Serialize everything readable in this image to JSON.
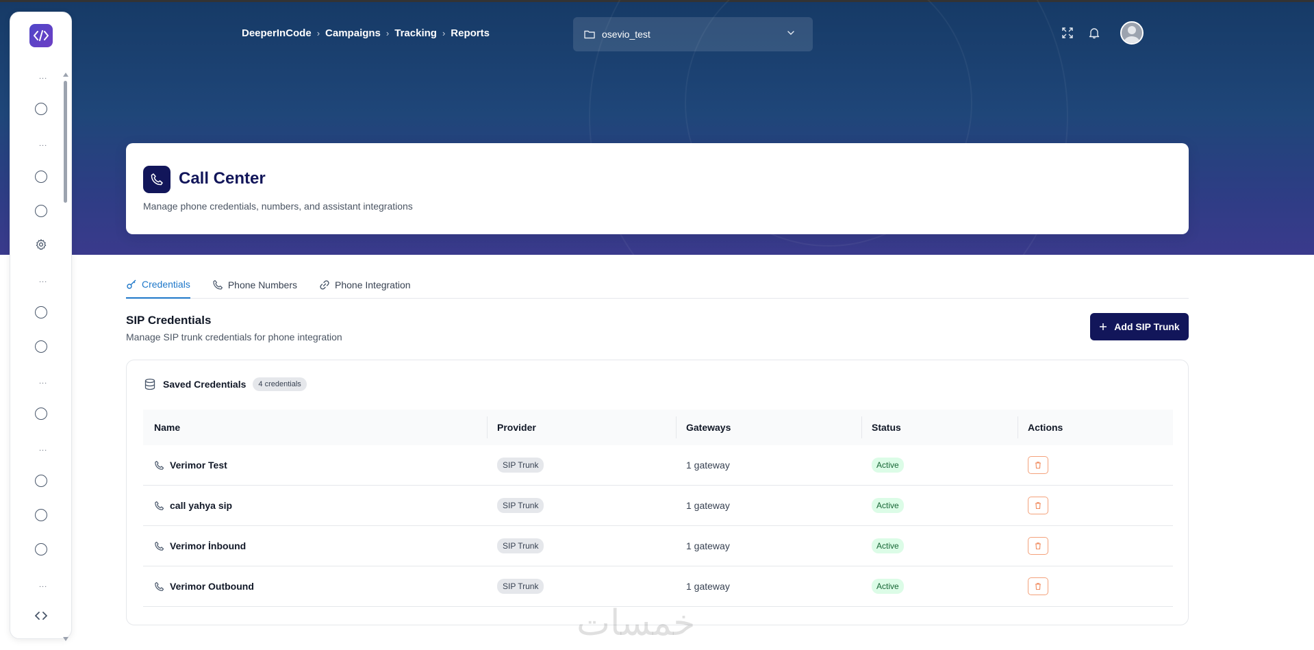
{
  "breadcrumb": [
    "DeeperInCode",
    "Campaigns",
    "Tracking",
    "Reports"
  ],
  "workspace": {
    "name": "osevio_test"
  },
  "header": {
    "title": "Call Center",
    "subtitle": "Manage phone credentials, numbers, and assistant integrations"
  },
  "tabs": [
    {
      "label": "Credentials",
      "icon": "key-icon",
      "active": true
    },
    {
      "label": "Phone Numbers",
      "icon": "phone-icon",
      "active": false
    },
    {
      "label": "Phone Integration",
      "icon": "link-icon",
      "active": false
    }
  ],
  "section": {
    "title": "SIP Credentials",
    "subtitle": "Manage SIP trunk credentials for phone integration",
    "add_button": "Add SIP Trunk"
  },
  "panel": {
    "title": "Saved Credentials",
    "count": "4 credentials"
  },
  "table": {
    "columns": [
      "Name",
      "Provider",
      "Gateways",
      "Status",
      "Actions"
    ],
    "rows": [
      {
        "name": "Verimor Test",
        "provider": "SIP Trunk",
        "gateways": "1 gateway",
        "status": "Active"
      },
      {
        "name": "call yahya sip",
        "provider": "SIP Trunk",
        "gateways": "1 gateway",
        "status": "Active"
      },
      {
        "name": "Verimor İnbound",
        "provider": "SIP Trunk",
        "gateways": "1 gateway",
        "status": "Active"
      },
      {
        "name": "Verimor Outbound",
        "provider": "SIP Trunk",
        "gateways": "1 gateway",
        "status": "Active"
      }
    ]
  },
  "sidebar": {
    "dots": "..."
  },
  "watermark": "خمسات",
  "colors": {
    "brand_dark": "#12165a",
    "active_tab": "#1d77c9",
    "status_active_bg": "#dcfce7",
    "delete_border": "#f4a17a"
  }
}
